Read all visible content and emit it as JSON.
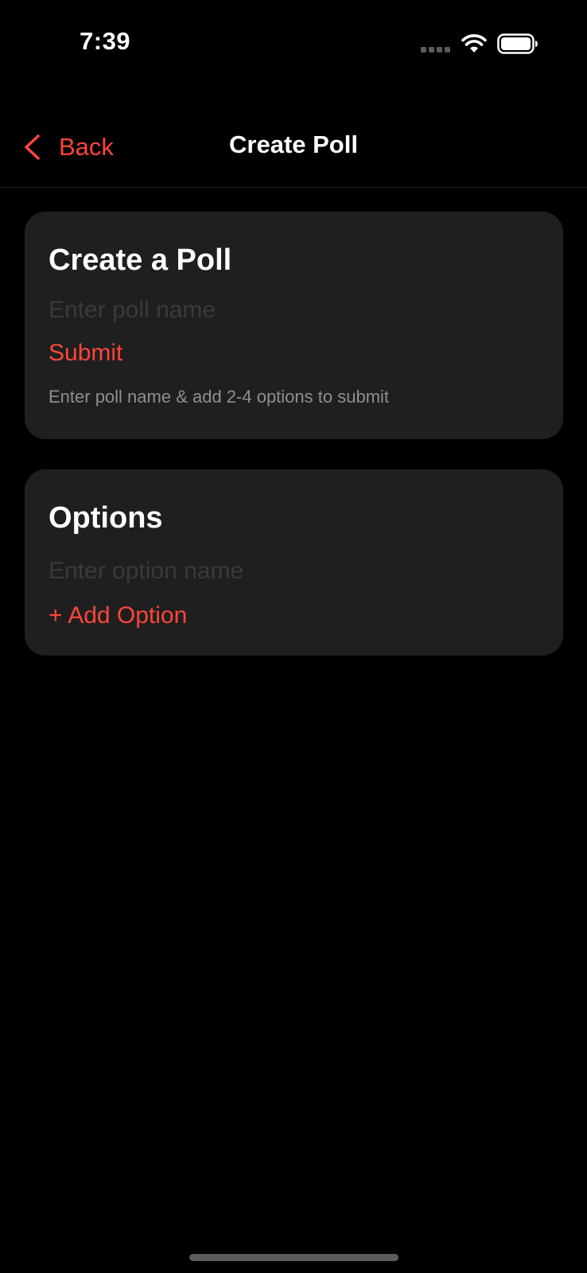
{
  "status_bar": {
    "time": "7:39"
  },
  "nav": {
    "back_label": "Back",
    "title": "Create Poll"
  },
  "poll_card": {
    "title": "Create a Poll",
    "name_placeholder": "Enter poll name",
    "name_value": "",
    "submit_label": "Submit",
    "helper": "Enter poll name & add 2-4 options to submit"
  },
  "options_card": {
    "title": "Options",
    "option_placeholder": "Enter option name",
    "option_value": "",
    "add_label": "+ Add Option"
  },
  "colors": {
    "accent": "#ff453a",
    "background": "#000000",
    "card": "#1f1f1f",
    "secondary_text": "#8e8e93"
  },
  "icons": {
    "back": "chevron-left-icon",
    "wifi": "wifi-icon",
    "battery": "battery-icon",
    "signal": "signal-dots-icon"
  }
}
